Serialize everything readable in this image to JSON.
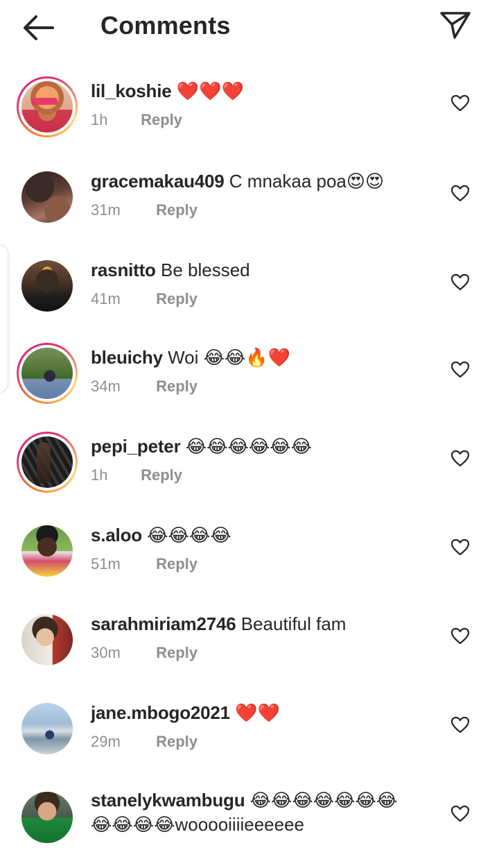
{
  "header": {
    "title": "Comments"
  },
  "comments": [
    {
      "username": "lil_koshie",
      "text": "",
      "emoji": "❤️❤️❤️",
      "time": "1h",
      "reply": "Reply",
      "story_ring": true
    },
    {
      "username": "gracemakau409",
      "text": "C mnakaa poa",
      "emoji": "😍😍",
      "time": "31m",
      "reply": "Reply",
      "story_ring": false
    },
    {
      "username": "rasnitto",
      "text": "Be blessed",
      "emoji": "",
      "time": "41m",
      "reply": "Reply",
      "story_ring": false
    },
    {
      "username": "bleuichy",
      "text": "Woi",
      "emoji": "😂😂🔥❤️",
      "time": "34m",
      "reply": "Reply",
      "story_ring": true
    },
    {
      "username": "pepi_peter",
      "text": "",
      "emoji": "😂😂😂😂😂😂",
      "time": "1h",
      "reply": "Reply",
      "story_ring": true
    },
    {
      "username": "s.aloo",
      "text": "",
      "emoji": "😂😂😂😂",
      "time": "51m",
      "reply": "Reply",
      "story_ring": false
    },
    {
      "username": "sarahmiriam2746",
      "text": "Beautiful fam",
      "emoji": "",
      "time": "30m",
      "reply": "Reply",
      "story_ring": false
    },
    {
      "username": "jane.mbogo2021",
      "text": "",
      "emoji": "❤️❤️",
      "time": "29m",
      "reply": "Reply",
      "story_ring": false
    },
    {
      "username": "stanelykwambugu",
      "text": "",
      "emoji": "😂😂😂😂😂😂😂",
      "emoji2": "😂😂😂😂",
      "text2": "wooooiiiieeeeee",
      "story_ring": false
    }
  ],
  "icons": {
    "back": "arrow-left-icon",
    "send": "paper-plane-icon",
    "like": "heart-outline-icon"
  },
  "colors": {
    "text": "#262626",
    "muted": "#8e8e8e",
    "ring_start": "#f58529",
    "ring_end": "#dd2a7b"
  }
}
